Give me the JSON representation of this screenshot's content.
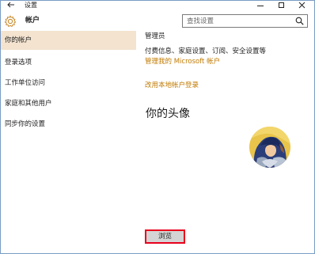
{
  "window": {
    "title": "设置"
  },
  "header": {
    "page_title": "帐户",
    "search_placeholder": "查找设置"
  },
  "sidebar": {
    "items": [
      {
        "label": "你的帐户",
        "active": true
      },
      {
        "label": "登录选项",
        "active": false
      },
      {
        "label": "工作单位访问",
        "active": false
      },
      {
        "label": "家庭和其他用户",
        "active": false
      },
      {
        "label": "同步你的设置",
        "active": false
      }
    ]
  },
  "main": {
    "role": "管理员",
    "info": "付费信息、家庭设置、订阅、安全设置等",
    "manage_link": "管理我的 Microsoft 帐户",
    "local_link": "改用本地帐户登录",
    "avatar_heading": "你的头像",
    "browse_label": "浏览"
  },
  "colors": {
    "accent": "#c17a00",
    "sidebar_active": "#f3e3cf",
    "highlight_border": "#e8001c"
  }
}
